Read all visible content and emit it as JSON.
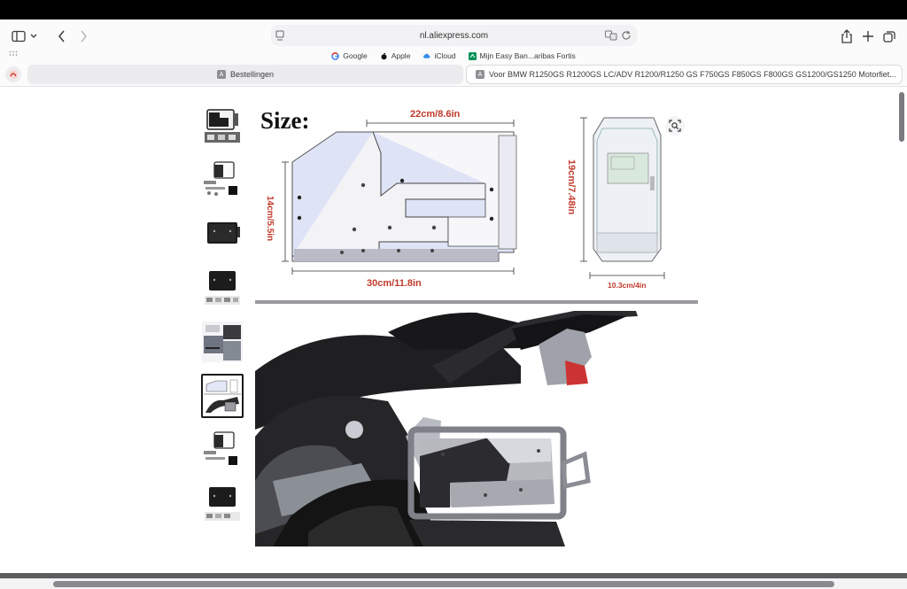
{
  "toolbar": {
    "url": "nl.aliexpress.com",
    "icons": {
      "sidebar": "sidebar-toggle-icon",
      "back": "chevron-left-icon",
      "forward": "chevron-right-icon",
      "share": "share-icon",
      "new_tab": "plus-icon",
      "tabs": "tab-overview-icon",
      "translate": "translate-icon",
      "reload": "reload-icon",
      "page_menu": "page-menu-icon"
    }
  },
  "bookmarks": [
    {
      "label": "Google",
      "icon": "google-icon",
      "color": "#4285f4"
    },
    {
      "label": "Apple",
      "icon": "apple-icon",
      "color": "#111111"
    },
    {
      "label": "iCloud",
      "icon": "cloud-icon",
      "color": "#3a8ee6"
    },
    {
      "label": "Mijn Easy Ban...aribas Fortis",
      "icon": "bank-icon",
      "color": "#00915a"
    }
  ],
  "tabs": [
    {
      "label": "Bestellingen",
      "favicon": "A"
    },
    {
      "label": "Voor BMW R1250GS R1200GS LC/ADV R1200/R1250 GS F750GS F850GS F800GS GS1200/GS1250 Motorfiet...",
      "favicon": "A"
    }
  ],
  "product_image": {
    "heading": "Size:",
    "dim_top": "22cm/8.6in",
    "dim_bottom": "30cm/11.8in",
    "dim_left": "14cm/5.5in",
    "dim_height": "19cm/7.48in",
    "dim_width": "10.3cm/4in"
  },
  "thumbnails": {
    "count": 8,
    "active_index": 5,
    "labels": [
      "tool-box-thumbnail",
      "mounting-kit-thumbnail",
      "black-box-thumbnail",
      "black-box-kit-thumbnail",
      "installation-thumbnail",
      "size-chart-thumbnail",
      "mounting-kit-thumbnail",
      "black-box-kit-thumbnail"
    ]
  },
  "colors": {
    "accent_red": "#c0392b",
    "box_blue": "#dfe3f6"
  }
}
